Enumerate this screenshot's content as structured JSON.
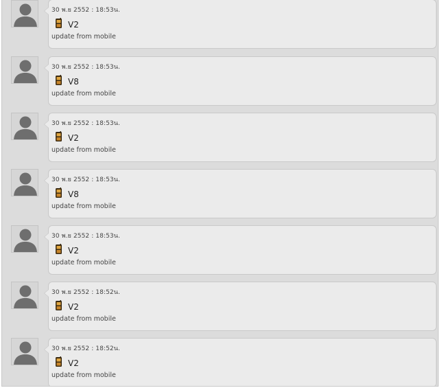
{
  "feed": {
    "posts": [
      {
        "timestamp": "30 พ.ย 2552 : 18:53น.",
        "status": "V2",
        "source": "update from mobile",
        "icon": "mobile-phone-icon"
      },
      {
        "timestamp": "30 พ.ย 2552 : 18:53น.",
        "status": "V8",
        "source": "update from mobile",
        "icon": "mobile-phone-icon"
      },
      {
        "timestamp": "30 พ.ย 2552 : 18:53น.",
        "status": "V2",
        "source": "update from mobile",
        "icon": "mobile-phone-icon"
      },
      {
        "timestamp": "30 พ.ย 2552 : 18:53น.",
        "status": "V8",
        "source": "update from mobile",
        "icon": "mobile-phone-icon"
      },
      {
        "timestamp": "30 พ.ย 2552 : 18:53น.",
        "status": "V2",
        "source": "update from mobile",
        "icon": "mobile-phone-icon"
      },
      {
        "timestamp": "30 พ.ย 2552 : 18:52น.",
        "status": "V2",
        "source": "update from mobile",
        "icon": "mobile-phone-icon"
      },
      {
        "timestamp": "30 พ.ย 2552 : 18:52น.",
        "status": "V2",
        "source": "update from mobile",
        "icon": "mobile-phone-icon"
      }
    ]
  },
  "colors": {
    "feed_background": "#dcdcdc",
    "bubble_background": "#ebebeb",
    "bubble_border": "#c9c9c9",
    "avatar_silhouette": "#6e6e6e",
    "phone_body": "#c8862a"
  }
}
